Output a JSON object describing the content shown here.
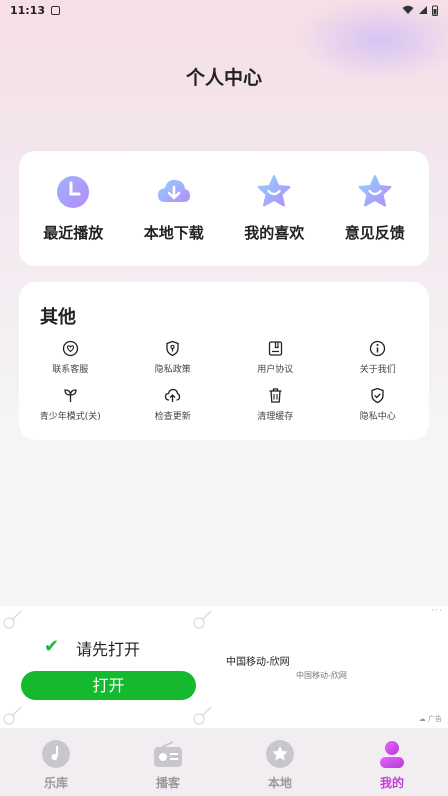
{
  "status_bar": {
    "time": "11:13"
  },
  "header": {
    "title": "个人中心"
  },
  "quick_actions": [
    {
      "label": "最近播放",
      "icon": "clock-icon"
    },
    {
      "label": "本地下载",
      "icon": "cloud-download-icon"
    },
    {
      "label": "我的喜欢",
      "icon": "star-smile-icon"
    },
    {
      "label": "意见反馈",
      "icon": "star-smile-icon"
    }
  ],
  "other": {
    "title": "其他",
    "items": [
      {
        "label": "联系客服",
        "icon": "heart-chat-icon"
      },
      {
        "label": "隐私政策",
        "icon": "shield-lock-icon"
      },
      {
        "label": "用户协议",
        "icon": "document-icon"
      },
      {
        "label": "关于我们",
        "icon": "info-icon"
      },
      {
        "label": "青少年模式(关)",
        "icon": "sprout-icon"
      },
      {
        "label": "检查更新",
        "icon": "cloud-upload-icon"
      },
      {
        "label": "清理缓存",
        "icon": "trash-icon"
      },
      {
        "label": "隐私中心",
        "icon": "shield-check-icon"
      }
    ]
  },
  "ad": {
    "prompt": "请先打开",
    "button": "打开",
    "advertiser_title": "中国移动-欣网",
    "advertiser_sub": "中国移动-欣网",
    "tag": "广告",
    "more": "···"
  },
  "tabs": [
    {
      "label": "乐库",
      "icon": "music-disc-icon",
      "active": false
    },
    {
      "label": "播客",
      "icon": "radio-icon",
      "active": false
    },
    {
      "label": "本地",
      "icon": "star-circle-icon",
      "active": false
    },
    {
      "label": "我的",
      "icon": "person-icon",
      "active": true
    }
  ],
  "colors": {
    "accent": "#c03fd8",
    "button_green": "#15b92d",
    "icon_blue": "#7b8df5"
  }
}
